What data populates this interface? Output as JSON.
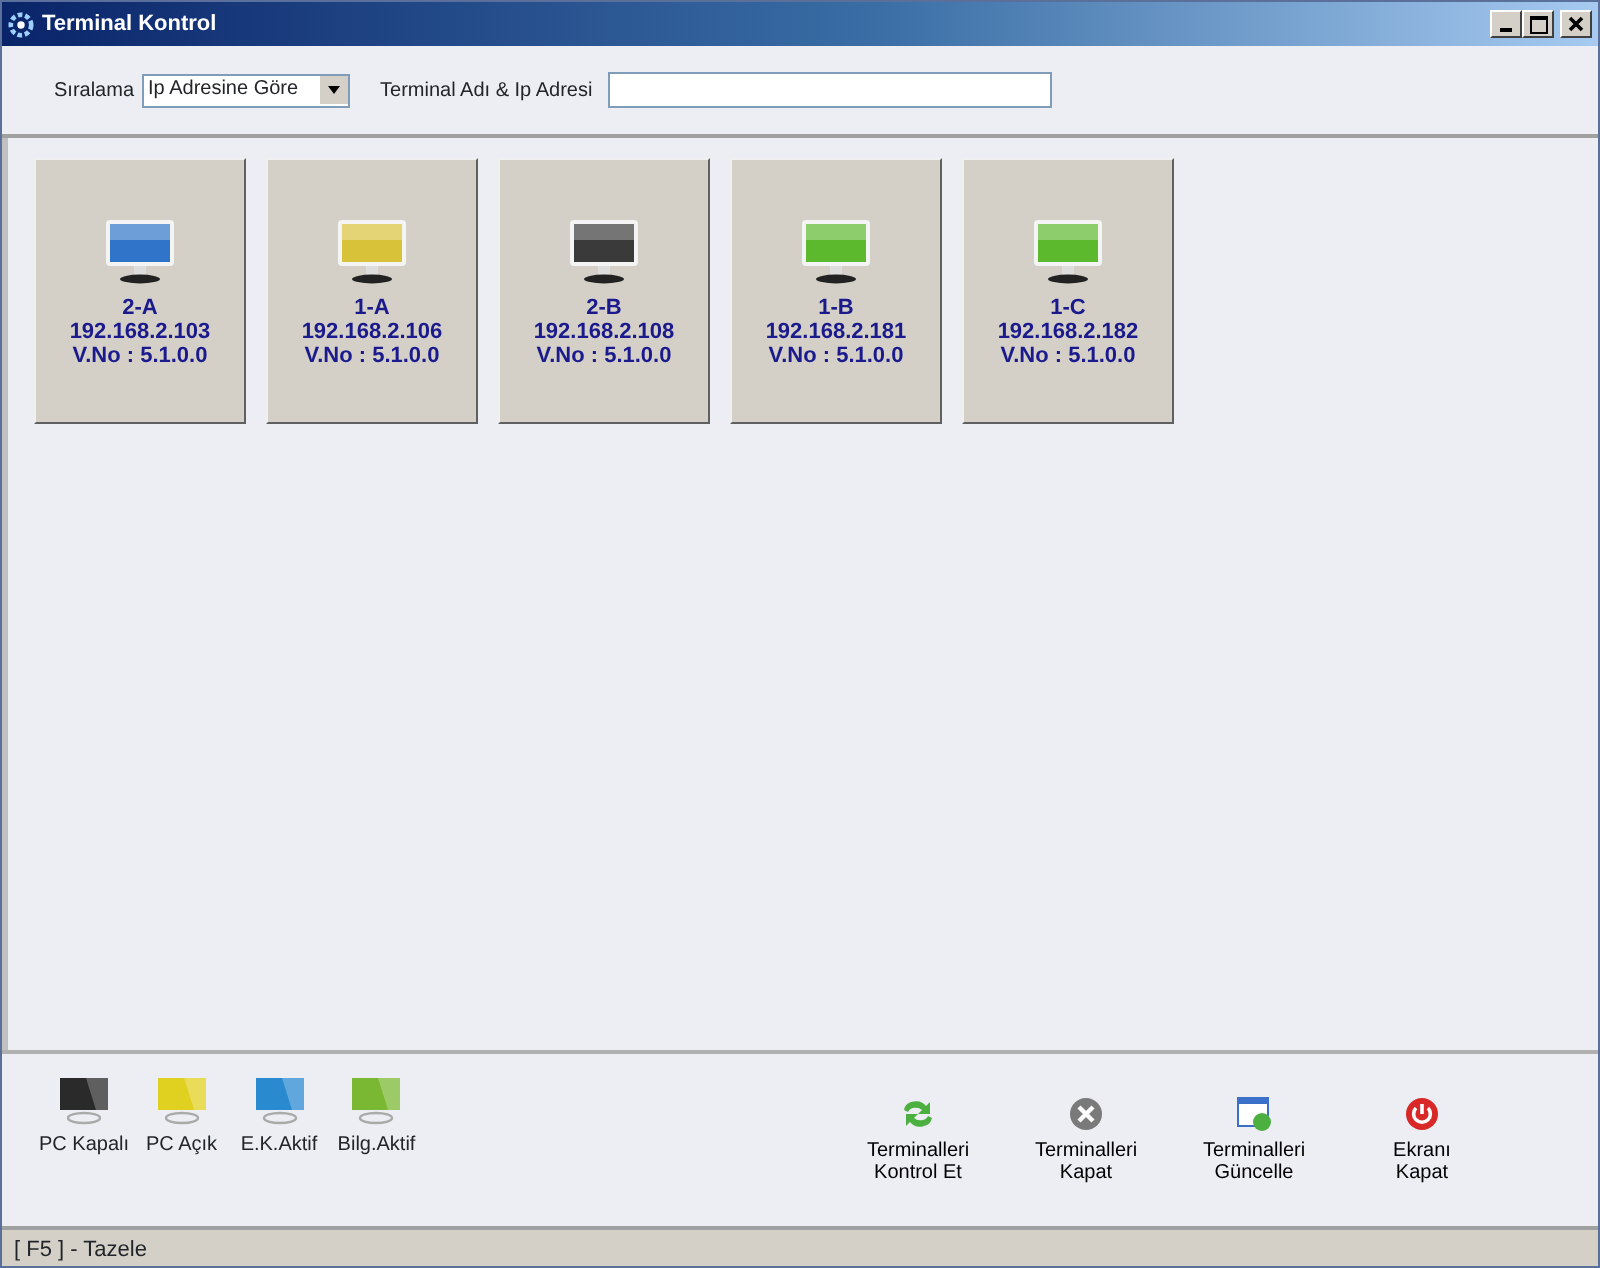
{
  "window": {
    "title": "Terminal Kontrol"
  },
  "filter": {
    "sort_label": "Sıralama",
    "sort_value": "Ip Adresine Göre",
    "search_label": "Terminal Adı & Ip Adresi"
  },
  "terminals": [
    {
      "name": "2-A",
      "ip": "192.168.2.103",
      "version": "V.No : 5.1.0.0",
      "color": "#2f74c8"
    },
    {
      "name": "1-A",
      "ip": "192.168.2.106",
      "version": "V.No : 5.1.0.0",
      "color": "#d8c23a"
    },
    {
      "name": "2-B",
      "ip": "192.168.2.108",
      "version": "V.No : 5.1.0.0",
      "color": "#3a3a3a"
    },
    {
      "name": "1-B",
      "ip": "192.168.2.181",
      "version": "V.No : 5.1.0.0",
      "color": "#5cb82c"
    },
    {
      "name": "1-C",
      "ip": "192.168.2.182",
      "version": "V.No : 5.1.0.0",
      "color": "#5cb82c"
    }
  ],
  "legend": [
    {
      "label": "PC Kapalı",
      "color": "#2a2a2a"
    },
    {
      "label": "PC Açık",
      "color": "#e0d020"
    },
    {
      "label": "E.K.Aktif",
      "color": "#2a8ad0"
    },
    {
      "label": "Bilg.Aktif",
      "color": "#7ab834"
    }
  ],
  "actions": [
    {
      "kind": "refresh",
      "label": "Terminalleri\nKontrol Et"
    },
    {
      "kind": "close",
      "label": "Terminalleri\nKapat"
    },
    {
      "kind": "update",
      "label": "Terminalleri\nGüncelle"
    },
    {
      "kind": "power",
      "label": "Ekranı\nKapat"
    }
  ],
  "status_bar": {
    "text": "[ F5 ] - Tazele"
  }
}
